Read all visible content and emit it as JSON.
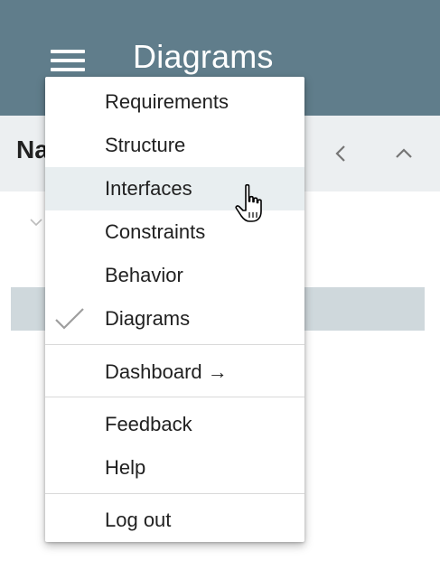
{
  "header": {
    "title": "Diagrams",
    "menu_icon": "hamburger-menu-icon",
    "background_color": "#607d8b"
  },
  "panel": {
    "title": "Na",
    "prev_icon": "chevron-left-icon",
    "up_icon": "chevron-up-icon",
    "expand_icon": "chevron-down-icon"
  },
  "menu": {
    "items": [
      {
        "label": "Requirements"
      },
      {
        "label": "Structure"
      },
      {
        "label": "Interfaces",
        "hovered": true
      },
      {
        "label": "Constraints"
      },
      {
        "label": "Behavior"
      },
      {
        "label": "Diagrams",
        "checked": true,
        "check_icon": "checkmark-icon"
      }
    ],
    "dashboard_label": "Dashboard →",
    "feedback_label": "Feedback",
    "help_label": "Help",
    "logout_label": "Log out",
    "hover_color": "#e8eef0"
  },
  "cursor": {
    "icon": "hand-pointer-cursor-icon"
  }
}
